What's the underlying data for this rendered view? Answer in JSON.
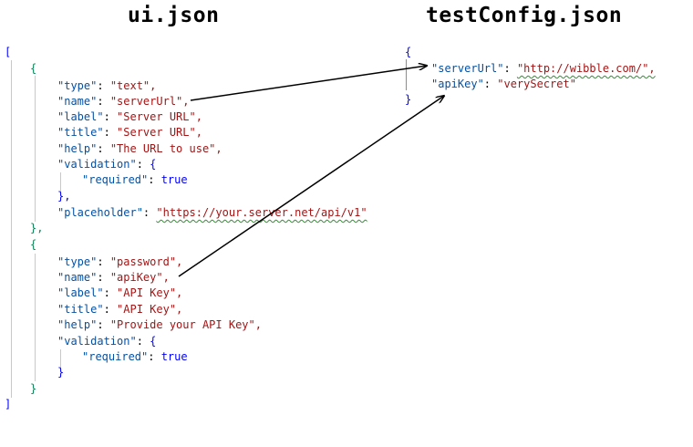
{
  "headings": {
    "left": "ui.json",
    "right": "testConfig.json"
  },
  "left": {
    "open": "[",
    "close": "]",
    "obj1_open": "{",
    "obj1_close": "},",
    "obj2_open": "{",
    "obj2_close": "}",
    "lines1": [
      {
        "k": "\"type\"",
        "v": "\"text\","
      },
      {
        "k": "\"name\"",
        "v": "\"serverUrl\","
      },
      {
        "k": "\"label\"",
        "v": "\"Server URL\","
      },
      {
        "k": "\"title\"",
        "v": "\"Server URL\","
      },
      {
        "k": "\"help\"",
        "v": "\"The URL to use\","
      },
      {
        "k": "\"validation\"",
        "v": "{"
      },
      {
        "k": "\"required\"",
        "v": "true"
      },
      {
        "k": "",
        "v": "},"
      },
      {
        "k": "\"placeholder\"",
        "v": "\"https://your.server.net/api/v1\""
      }
    ],
    "lines2": [
      {
        "k": "\"type\"",
        "v": "\"password\","
      },
      {
        "k": "\"name\"",
        "v": "\"apiKey\","
      },
      {
        "k": "\"label\"",
        "v": "\"API Key\","
      },
      {
        "k": "\"title\"",
        "v": "\"API Key\","
      },
      {
        "k": "\"help\"",
        "v": "\"Provide your API Key\","
      },
      {
        "k": "\"validation\"",
        "v": "{"
      },
      {
        "k": "\"required\"",
        "v": "true"
      },
      {
        "k": "",
        "v": "}"
      }
    ]
  },
  "right": {
    "open": "{",
    "close": "}",
    "lines": [
      {
        "k": "\"serverUrl\"",
        "v": "\"http://wibble.com/\","
      },
      {
        "k": "\"apiKey\"",
        "v": "\"verySecret\""
      }
    ]
  }
}
